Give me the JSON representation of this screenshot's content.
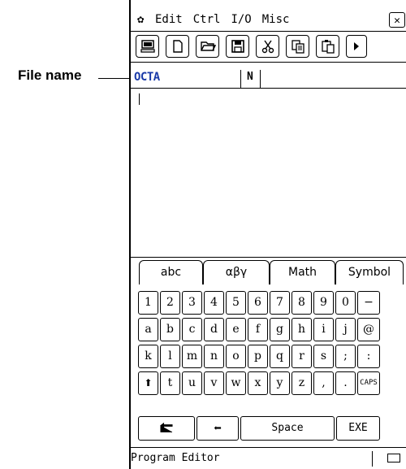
{
  "annotation": {
    "file_name_label": "File name"
  },
  "menubar": {
    "gear_icon": "gear-icon",
    "menus": [
      "Edit",
      "Ctrl",
      "I/O",
      "Misc"
    ],
    "close_icon": "close-icon"
  },
  "toolbar": {
    "buttons": [
      "computer-icon",
      "new-file-icon",
      "open-folder-icon",
      "save-icon",
      "cut-icon",
      "copy-icon",
      "paste-icon",
      "more-icon"
    ]
  },
  "file_line": {
    "file_name": "OCTA",
    "mode": "N"
  },
  "keyboard": {
    "tabs": [
      "abc",
      "αβγ",
      "Math",
      "Symbol"
    ],
    "rows": [
      [
        "1",
        "2",
        "3",
        "4",
        "5",
        "6",
        "7",
        "8",
        "9",
        "0",
        "−"
      ],
      [
        "a",
        "b",
        "c",
        "d",
        "e",
        "f",
        "g",
        "h",
        "i",
        "j",
        "@"
      ],
      [
        "k",
        "l",
        "m",
        "n",
        "o",
        "p",
        "q",
        "r",
        "s",
        ";",
        ":"
      ],
      [
        "⬆",
        "t",
        "u",
        "v",
        "w",
        "x",
        "y",
        "z",
        ",",
        ".",
        "CAPS"
      ]
    ],
    "bottom_row": {
      "tab_icon": "tab-icon",
      "backspace_icon": "left-arrow-icon",
      "space": "Space",
      "exe": "EXE"
    }
  },
  "status": {
    "text": "Program Editor",
    "battery_icon": "battery-icon"
  }
}
